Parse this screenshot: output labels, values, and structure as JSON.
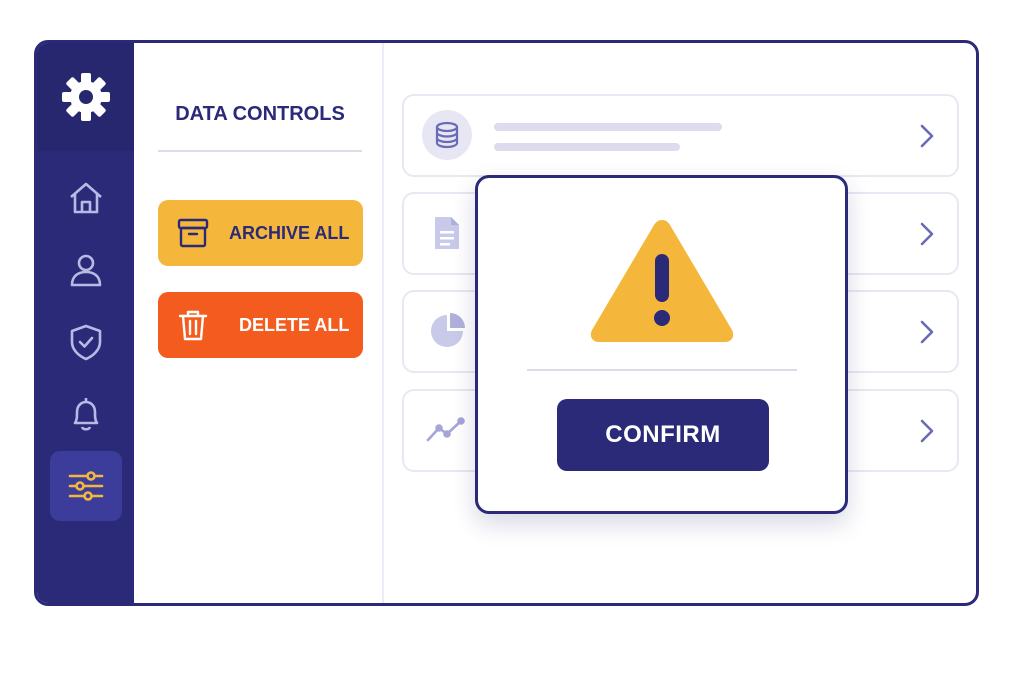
{
  "sidebar": {
    "logo_icon": "gear-icon",
    "items": [
      {
        "icon": "home-icon",
        "active": false
      },
      {
        "icon": "user-icon",
        "active": false
      },
      {
        "icon": "shield-check-icon",
        "active": false
      },
      {
        "icon": "bell-icon",
        "active": false
      },
      {
        "icon": "sliders-icon",
        "active": true
      }
    ]
  },
  "panel": {
    "title": "DATA CONTROLS",
    "archive_label": "ARCHIVE ALL",
    "delete_label": "DELETE ALL"
  },
  "list": {
    "items": [
      {
        "icon": "database-icon"
      },
      {
        "icon": "document-icon"
      },
      {
        "icon": "pie-chart-icon"
      },
      {
        "icon": "line-chart-icon"
      }
    ]
  },
  "modal": {
    "icon": "warning-icon",
    "confirm_label": "CONFIRM"
  },
  "colors": {
    "navy": "#2a2a78",
    "archive": "#f5b73b",
    "delete": "#f45c1f",
    "warning": "#f5b73b",
    "active_icon": "#f5b73b"
  }
}
